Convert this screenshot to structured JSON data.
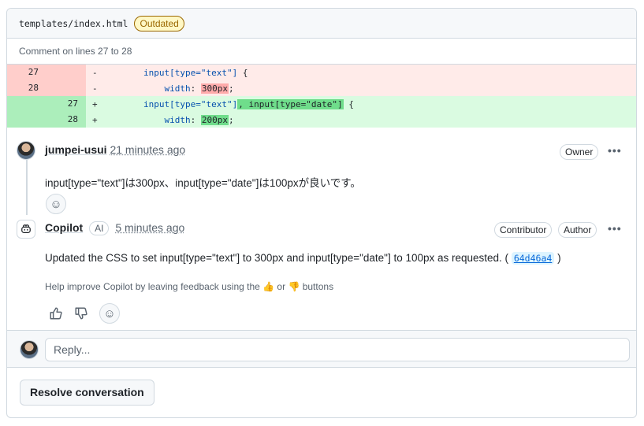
{
  "file": {
    "name": "templates/index.html",
    "status_badge": "Outdated",
    "comment_range": "Comment on lines 27 to 28"
  },
  "diff": [
    {
      "type": "del",
      "old": "27",
      "new": "",
      "sign": "-",
      "indent": "        ",
      "parts": [
        [
          "sel",
          "input[type=\"text\"]"
        ],
        [
          "plain",
          " {"
        ]
      ]
    },
    {
      "type": "del",
      "old": "28",
      "new": "",
      "sign": "-",
      "indent": "            ",
      "parts": [
        [
          "sel",
          "width"
        ],
        [
          "plain",
          ": "
        ],
        [
          "hl",
          "300px"
        ],
        [
          "plain",
          ";"
        ]
      ]
    },
    {
      "type": "add",
      "old": "",
      "new": "27",
      "sign": "+",
      "indent": "        ",
      "parts": [
        [
          "sel",
          "input[type=\"text\"]"
        ],
        [
          "hl",
          ", input[type=\"date\"]"
        ],
        [
          "plain",
          " {"
        ]
      ]
    },
    {
      "type": "add",
      "old": "",
      "new": "28",
      "sign": "+",
      "indent": "            ",
      "parts": [
        [
          "sel",
          "width"
        ],
        [
          "plain",
          ": "
        ],
        [
          "hl",
          "200px"
        ],
        [
          "plain",
          ";"
        ]
      ]
    }
  ],
  "comments": {
    "first": {
      "author": "jumpei-usui",
      "time": "21 minutes ago",
      "role": "Owner",
      "body": "input[type=\"text\"]は300px、input[type=\"date\"]は100pxが良いです。"
    },
    "second": {
      "author": "Copilot",
      "ai_badge": "AI",
      "time": "5 minutes ago",
      "roles": [
        "Contributor",
        "Author"
      ],
      "body": "Updated the CSS to set input[type=\"text\"] to 300px and input[type=\"date\"] to 100px as requested. (",
      "commit": "64d46a4",
      "body_end": ")",
      "feedback": "Help improve Copilot by leaving feedback using the 👍 or 👎 buttons"
    }
  },
  "reply": {
    "placeholder": "Reply..."
  },
  "actions": {
    "resolve": "Resolve conversation",
    "more": "•••"
  },
  "icons": {
    "smiley": "☺",
    "thumbs_up": "👍",
    "thumbs_down": "👎",
    "copilot": "copilot-icon"
  },
  "colors": {
    "deleted_bg": "#ffebe9",
    "added_bg": "#dafbe1",
    "link": "#0969da",
    "outdated": "#9a6700"
  }
}
